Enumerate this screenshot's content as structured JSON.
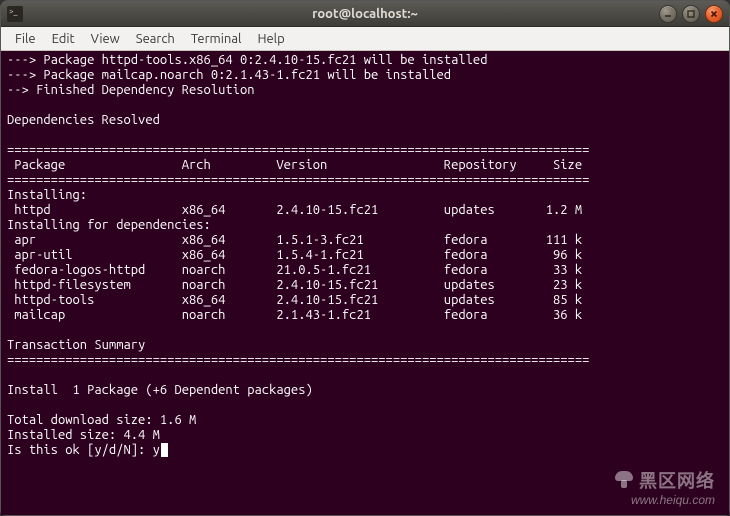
{
  "titlebar": {
    "title": "root@localhost:~"
  },
  "menus": [
    "File",
    "Edit",
    "View",
    "Search",
    "Terminal",
    "Help"
  ],
  "term": {
    "l1": "---> Package httpd-tools.x86_64 0:2.4.10-15.fc21 will be installed",
    "l2": "---> Package mailcap.noarch 0:2.1.43-1.fc21 will be installed",
    "l3": "--> Finished Dependency Resolution",
    "blank": "",
    "deps_resolved": "Dependencies Resolved",
    "divider": "================================================================================",
    "header": " Package                Arch         Version                Repository     Size",
    "inst_hdr": "Installing:",
    "httpd": " httpd                  x86_64       2.4.10-15.fc21         updates       1.2 M",
    "dep_hdr": "Installing for dependencies:",
    "apr": " apr                    x86_64       1.5.1-3.fc21           fedora        111 k",
    "aprutil": " apr-util               x86_64       1.5.4-1.fc21           fedora         96 k",
    "flogos": " fedora-logos-httpd     noarch       21.0.5-1.fc21          fedora         33 k",
    "hfiles": " httpd-filesystem       noarch       2.4.10-15.fc21         updates        23 k",
    "htools": " httpd-tools            x86_64       2.4.10-15.fc21         updates        85 k",
    "mailcap": " mailcap                noarch       2.1.43-1.fc21          fedora         36 k",
    "txn_summary": "Transaction Summary",
    "install_line": "Install  1 Package (+6 Dependent packages)",
    "dl_size": "Total download size: 1.6 M",
    "inst_size": "Installed size: 4.4 M",
    "prompt": "Is this ok [y/d/N]: y"
  },
  "watermark": {
    "zh": "黑区网络",
    "url": "www.heiqu.com"
  }
}
